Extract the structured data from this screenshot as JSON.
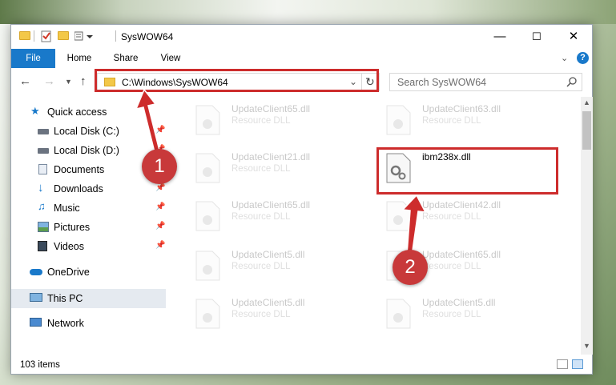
{
  "window": {
    "title": "SysWOW64",
    "controls": {
      "minimize": "—",
      "maximize": "☐",
      "close": "✕"
    }
  },
  "ribbon": {
    "tabs": [
      "File",
      "Home",
      "Share",
      "View"
    ],
    "help_icon": "?"
  },
  "address_bar": {
    "path": "C:\\Windows\\SysWOW64",
    "refresh_icon": "↻"
  },
  "search": {
    "placeholder": "Search SysWOW64"
  },
  "nav_pane": {
    "items": [
      {
        "label": "Quick access",
        "icon": "star-icon",
        "pinned": false
      },
      {
        "label": "Local Disk (C:)",
        "icon": "drive-icon",
        "pinned": true
      },
      {
        "label": "Local Disk (D:)",
        "icon": "drive-icon",
        "pinned": true
      },
      {
        "label": "Documents",
        "icon": "documents-icon",
        "pinned": true
      },
      {
        "label": "Downloads",
        "icon": "downloads-icon",
        "pinned": true
      },
      {
        "label": "Music",
        "icon": "music-icon",
        "pinned": true
      },
      {
        "label": "Pictures",
        "icon": "pictures-icon",
        "pinned": true
      },
      {
        "label": "Videos",
        "icon": "videos-icon",
        "pinned": true
      },
      {
        "label": "OneDrive",
        "icon": "cloud-icon",
        "pinned": false
      },
      {
        "label": "This PC",
        "icon": "computer-icon",
        "pinned": false,
        "selected": true
      },
      {
        "label": "Network",
        "icon": "network-icon",
        "pinned": false
      }
    ]
  },
  "files": [
    {
      "name": "UpdateClient65.dll",
      "desc": "Resource DLL",
      "faded": true
    },
    {
      "name": "UpdateClient63.dll",
      "desc": "Resource DLL",
      "faded": true
    },
    {
      "name": "UpdateClient21.dll",
      "desc": "Resource DLL",
      "faded": true
    },
    {
      "name": "ibm238x.dll",
      "desc": "",
      "faded": false
    },
    {
      "name": "UpdateClient65.dll",
      "desc": "Resource DLL",
      "faded": true
    },
    {
      "name": "UpdateClient42.dll",
      "desc": "Resource DLL",
      "faded": true
    },
    {
      "name": "UpdateClient5.dll",
      "desc": "Resource DLL",
      "faded": true
    },
    {
      "name": "UpdateClient65.dll",
      "desc": "Resource DLL",
      "faded": true
    },
    {
      "name": "UpdateClient5.dll",
      "desc": "Resource DLL",
      "faded": true
    },
    {
      "name": "UpdateClient5.dll",
      "desc": "Resource DLL",
      "faded": true
    }
  ],
  "status_bar": {
    "item_count": "103 items"
  },
  "annotations": {
    "step1": "1",
    "step2": "2",
    "color": "#cd2c2c"
  }
}
